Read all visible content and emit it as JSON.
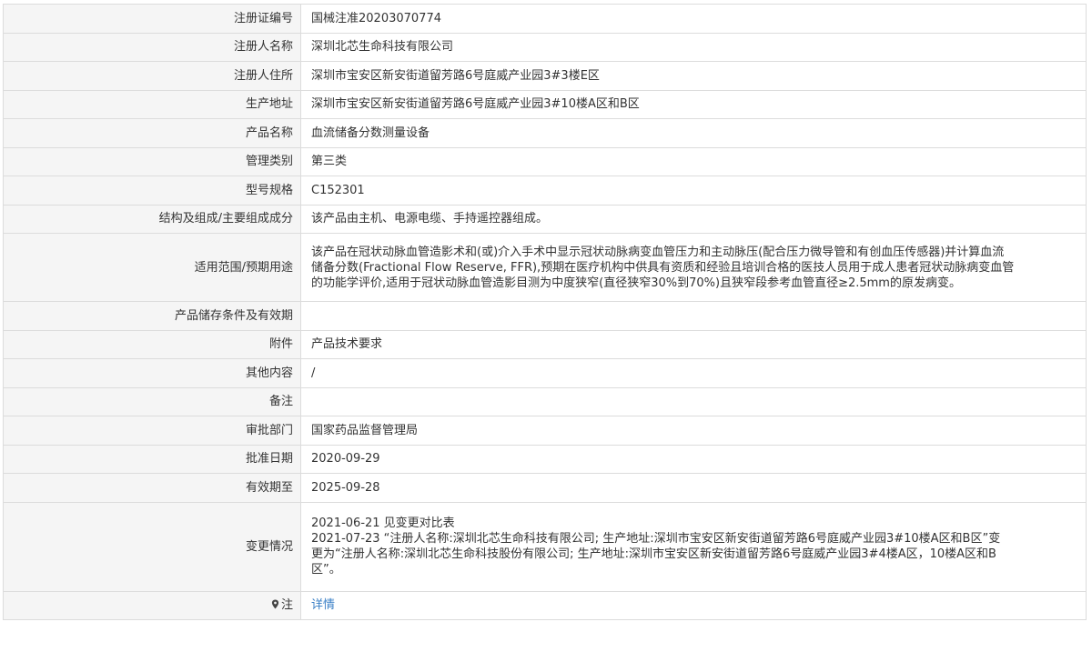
{
  "rows": [
    {
      "label": "注册证编号",
      "value": "国械注准20203070774"
    },
    {
      "label": "注册人名称",
      "value": "深圳北芯生命科技有限公司"
    },
    {
      "label": "注册人住所",
      "value": "深圳市宝安区新安街道留芳路6号庭威产业园3#3楼E区"
    },
    {
      "label": "生产地址",
      "value": "深圳市宝安区新安街道留芳路6号庭威产业园3#10楼A区和B区"
    },
    {
      "label": "产品名称",
      "value": "血流储备分数测量设备"
    },
    {
      "label": "管理类别",
      "value": "第三类"
    },
    {
      "label": "型号规格",
      "value": "C152301"
    },
    {
      "label": "结构及组成/主要组成成分",
      "value": "该产品由主机、电源电缆、手持遥控器组成。"
    },
    {
      "label": "适用范围/预期用途",
      "value_lines": [
        "该产品在冠状动脉血管造影术和(或)介入手术中显示冠状动脉病变血管压力和主动脉压(配合压力微导管和有创血压传感器)并计算血流",
        "储备分数(Fractional Flow Reserve, FFR),预期在医疗机构中供具有资质和经验且培训合格的医技人员用于成人患者冠状动脉病变血管",
        "的功能学评价,适用于冠状动脉血管造影目测为中度狭窄(直径狭窄30%到70%)且狭窄段参考血管直径≥2.5mm的原发病变。"
      ]
    },
    {
      "label": "产品储存条件及有效期",
      "value": ""
    },
    {
      "label": "附件",
      "value": "产品技术要求"
    },
    {
      "label": "其他内容",
      "value": "/"
    },
    {
      "label": "备注",
      "value": ""
    },
    {
      "label": "审批部门",
      "value": "国家药品监督管理局"
    },
    {
      "label": "批准日期",
      "value": "2020-09-29"
    },
    {
      "label": "有效期至",
      "value": "2025-09-28"
    },
    {
      "label": "变更情况",
      "value_lines": [
        "2021-06-21 见变更对比表",
        "2021-07-23 “注册人名称:深圳北芯生命科技有限公司; 生产地址:深圳市宝安区新安街道留芳路6号庭威产业园3#10楼A区和B区”变",
        "更为“注册人名称:深圳北芯生命科技股份有限公司; 生产地址:深圳市宝安区新安街道留芳路6号庭威产业园3#4楼A区，10楼A区和B",
        "区”。"
      ]
    },
    {
      "label": "注",
      "value": "详情",
      "icon": "pin-icon"
    }
  ],
  "colors": {
    "label_bg": "#f5f5f5",
    "border": "#dcdcdc",
    "link": "#3a7fc6"
  }
}
